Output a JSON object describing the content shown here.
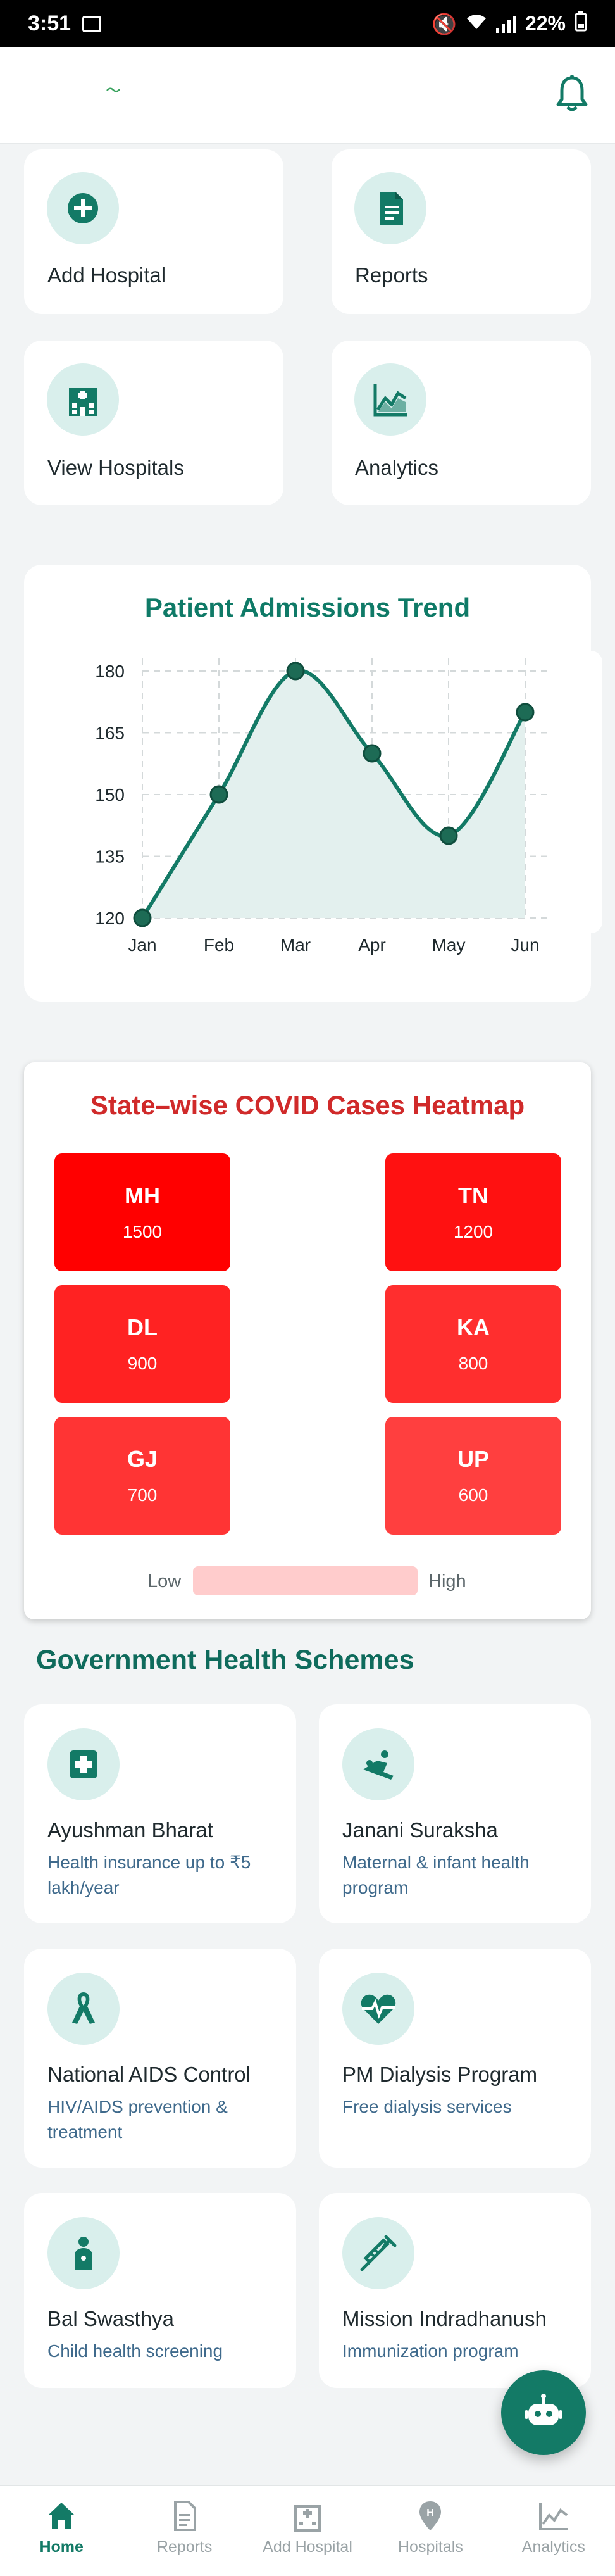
{
  "status_bar": {
    "time": "3:51",
    "battery": "22%"
  },
  "quick_actions": [
    {
      "label": "Add Hospital",
      "icon": "add-circle-icon"
    },
    {
      "label": "Reports",
      "icon": "document-icon"
    },
    {
      "label": "View Hospitals",
      "icon": "hospital-building-icon"
    },
    {
      "label": "Analytics",
      "icon": "line-chart-icon"
    }
  ],
  "admissions": {
    "title": "Patient Admissions Trend"
  },
  "chart_data": {
    "type": "line",
    "title": "Patient Admissions Trend",
    "categories": [
      "Jan",
      "Feb",
      "Mar",
      "Apr",
      "May",
      "Jun"
    ],
    "values": [
      120,
      150,
      180,
      160,
      140,
      170
    ],
    "yticks": [
      "120",
      "135",
      "150",
      "165",
      "180"
    ],
    "ylim": [
      120,
      180
    ],
    "grid": true,
    "color": "#137a66",
    "fill": "#e3f0ee"
  },
  "heatmap": {
    "title": "State–wise COVID Cases Heatmap",
    "tiles": [
      {
        "code": "MH",
        "value": "1500",
        "color": "#ff0000"
      },
      {
        "code": "TN",
        "value": "1200",
        "color": "#ff1111"
      },
      {
        "code": "DL",
        "value": "900",
        "color": "#ff2222"
      },
      {
        "code": "KA",
        "value": "800",
        "color": "#ff2e2e"
      },
      {
        "code": "GJ",
        "value": "700",
        "color": "#ff3434"
      },
      {
        "code": "UP",
        "value": "600",
        "color": "#ff3f3f"
      }
    ],
    "legend_low": "Low",
    "legend_high": "High"
  },
  "schemes": {
    "title": "Government Health Schemes",
    "items": [
      {
        "title": "Ayushman Bharat",
        "desc": [
          "Health insurance up to ₹5",
          "lakh/year"
        ],
        "icon": "medical-cross-icon"
      },
      {
        "title": "Janani Suraksha",
        "desc": [
          "Maternal & infant health",
          "program"
        ],
        "icon": "mother-child-icon"
      },
      {
        "title": "National AIDS Control",
        "desc": [
          "HIV/AIDS prevention &",
          "treatment"
        ],
        "icon": "awareness-ribbon-icon"
      },
      {
        "title": "PM Dialysis Program",
        "desc": [
          "Free dialysis services",
          ""
        ],
        "icon": "heart-pulse-icon"
      },
      {
        "title": "Bal Swasthya",
        "desc": [
          "Child health screening",
          ""
        ],
        "icon": "child-icon"
      },
      {
        "title": "Mission Indradhanush",
        "desc": [
          "Immunization program",
          ""
        ],
        "icon": "syringe-icon"
      }
    ]
  },
  "nav": {
    "items": [
      {
        "label": "Home",
        "active": true
      },
      {
        "label": "Reports",
        "active": false
      },
      {
        "label": "Add Hospital",
        "active": false
      },
      {
        "label": "Hospitals",
        "active": false
      },
      {
        "label": "Analytics",
        "active": false
      }
    ]
  }
}
